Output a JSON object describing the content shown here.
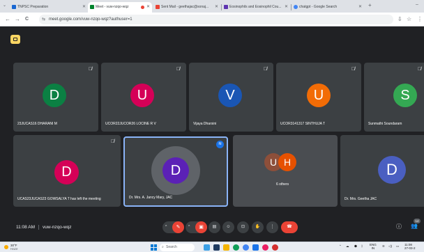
{
  "browser": {
    "tabs": [
      {
        "title": "TNPSC Preparation",
        "favicon_color": "#1967d2",
        "active": false
      },
      {
        "title": "Meet - vuw-nzqo-wqz",
        "favicon_color": "#00832d",
        "active": true
      },
      {
        "title": "Sent Mail - geethajac@sonaj...",
        "favicon_color": "#ea4335",
        "active": false
      },
      {
        "title": "Eosinophils and Eosinophil Cou...",
        "favicon_color": "#5e35b1",
        "active": false
      },
      {
        "title": "chatgpt - Google Search",
        "favicon_color": "#4285f4",
        "active": false
      }
    ],
    "new_tab": "+",
    "address": "meet.google.com/vuw-nzqo-wqz?authuser=1",
    "nav": {
      "back": "←",
      "forward": "→",
      "reload": "C",
      "download": "⇩",
      "star": "☆",
      "menu": "⋮"
    }
  },
  "meeting": {
    "participants_row1": [
      {
        "initial": "D",
        "name": "23JUCAS16 DHARANI M",
        "color": "#0b8043"
      },
      {
        "initial": "U",
        "name": "UCOR22JUCOR26 LOCINE R V",
        "color": "#d50057"
      },
      {
        "initial": "V",
        "name": "Vijaya Dharsini",
        "color": "#1a56b4"
      },
      {
        "initial": "U",
        "name": "UCOR3141317 SINTHUJA T",
        "color": "#f26c06"
      },
      {
        "initial": "S",
        "name": "Sunmathi Soundaram",
        "color": "#34a853"
      }
    ],
    "participants_row2": [
      {
        "initial": "D",
        "name": "UCAS23JUCAS23 GOWSALYA T has left the meeting",
        "color": "#d50057"
      },
      {
        "initial": "D",
        "name": "Dr. Mrs. A. Jancy Mary, JAC",
        "color": "#5b21b6"
      },
      {
        "initial": "D",
        "name": "Dr. Mrs. Geetha JAC",
        "color": "#4a5fc1"
      }
    ],
    "others": {
      "initials": [
        "U",
        "H"
      ],
      "colors": [
        "#8d4f3a",
        "#e65100"
      ],
      "label": "6 others"
    },
    "time": "11:08 AM",
    "code": "vuw-nzqo-wqz",
    "participant_count_badge": "14"
  },
  "controls": {
    "mic_icon": "mic-off-icon",
    "camera_icon": "camera-off-icon",
    "captions_icon": "captions-icon",
    "emoji_icon": "emoji-icon",
    "present_icon": "present-icon",
    "hand_icon": "raise-hand-icon",
    "more_icon": "more-icon",
    "leave_icon": "leave-call-icon"
  },
  "taskbar": {
    "weather_temp": "30°F",
    "weather_desc": "Haze",
    "search_placeholder": "Search",
    "lang": "ENG",
    "region": "IN",
    "clock_time": "11:08",
    "clock_date": "27-03-2"
  }
}
